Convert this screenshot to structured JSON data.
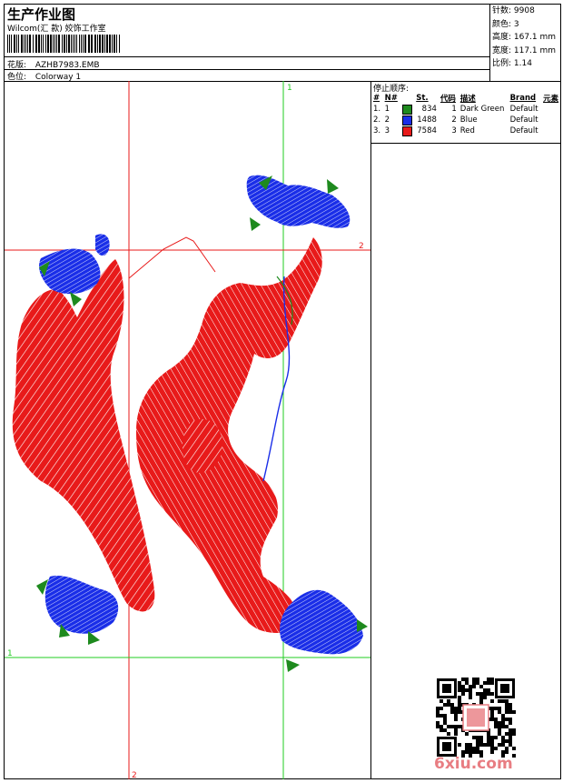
{
  "header": {
    "title": "生产作业图",
    "subtitle": "Wilcom(汇 款) 姣饰工作室",
    "pattern_label": "花版:",
    "pattern_value": "AZHB7983.EMB",
    "colorway_label": "色位:",
    "colorway_value": "Colorway 1"
  },
  "stats": {
    "stitches": "针数: 9908",
    "colors": "颜色: 3",
    "height": "高度: 167.1 mm",
    "width": "宽度: 117.1 mm",
    "ratio": "比例: 1.14"
  },
  "stop_table": {
    "heading": "停止顺序:",
    "columns": [
      "#",
      "N#",
      "St.",
      "代码",
      "描述",
      "Brand",
      "元素"
    ],
    "rows": [
      {
        "seq": "1.",
        "n": "1",
        "color": "#1e8a1e",
        "st": "834",
        "code": "1",
        "desc": "Dark Green",
        "brand": "Default"
      },
      {
        "seq": "2.",
        "n": "2",
        "color": "#1a2ee8",
        "st": "1488",
        "code": "2",
        "desc": "Blue",
        "brand": "Default"
      },
      {
        "seq": "3.",
        "n": "3",
        "color": "#e81a1a",
        "st": "7584",
        "code": "3",
        "desc": "Red",
        "brand": "Default"
      }
    ]
  },
  "guides": {
    "v1_label": "1",
    "v2_label": "2",
    "h1_label": "1",
    "h2_label": "2",
    "red_guide_color": "#e81a1a",
    "green_guide_color": "#22cc22"
  },
  "watermark": "6xiu.com"
}
